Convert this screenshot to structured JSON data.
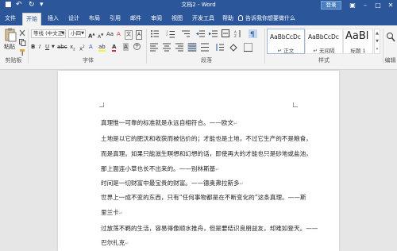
{
  "titlebar": {
    "title": "文档2 - Word",
    "login": "登录",
    "save_glyph": "■",
    "undo_glyph": "↶",
    "redo_glyph": "↻",
    "customize_glyph": "▾",
    "ribbon_opts_glyph": "▣",
    "minimize_glyph": "–",
    "maximize_glyph": "□",
    "close_glyph": "✕"
  },
  "tabs": [
    "文件",
    "开始",
    "插入",
    "设计",
    "布局",
    "引用",
    "邮件",
    "审阅",
    "视图",
    "开发工具",
    "帮助"
  ],
  "active_tab": 1,
  "tell_me": "告诉我你想要做什么",
  "ribbon": {
    "clipboard": {
      "paste": "粘贴",
      "label": "剪贴板"
    },
    "font": {
      "name": "等线 (中文正)",
      "size": "小四",
      "label": "字体"
    },
    "paragraph": {
      "label": "段落"
    },
    "styles": {
      "label": "样式",
      "cards": [
        {
          "preview": "AaBbCcDc",
          "name": "↵ 正文"
        },
        {
          "preview": "AaBbCcDc",
          "name": "↵ 无间隔"
        },
        {
          "preview": "AaBl",
          "name": "标题 1"
        }
      ]
    },
    "editing": {
      "label": "编辑"
    }
  },
  "document": {
    "lines": [
      "真理惟一可靠的标准就是永远自相符合。——欧文",
      "土地是以它的肥沃和收获而被估价的；才能也是土地，不过它生产的不是粮食，",
      "而是真理。如果只能滋生瞑想和幻想的话，即使再大的才能也只是砂地或盐池，",
      "那上面连小草也长不出来的。——别林斯基",
      "时间是一切财富中最宝贵的财富。——德奥弗拉斯多",
      "世界上一成不变的东西，只有“任何事物都是在不断变化的”这条真理。——斯",
      "里兰卡",
      "过放荡不羁的生活，容易得像顺水推舟，但是要结识良朋益友，却难如登天。——",
      "巴尔扎克"
    ]
  }
}
